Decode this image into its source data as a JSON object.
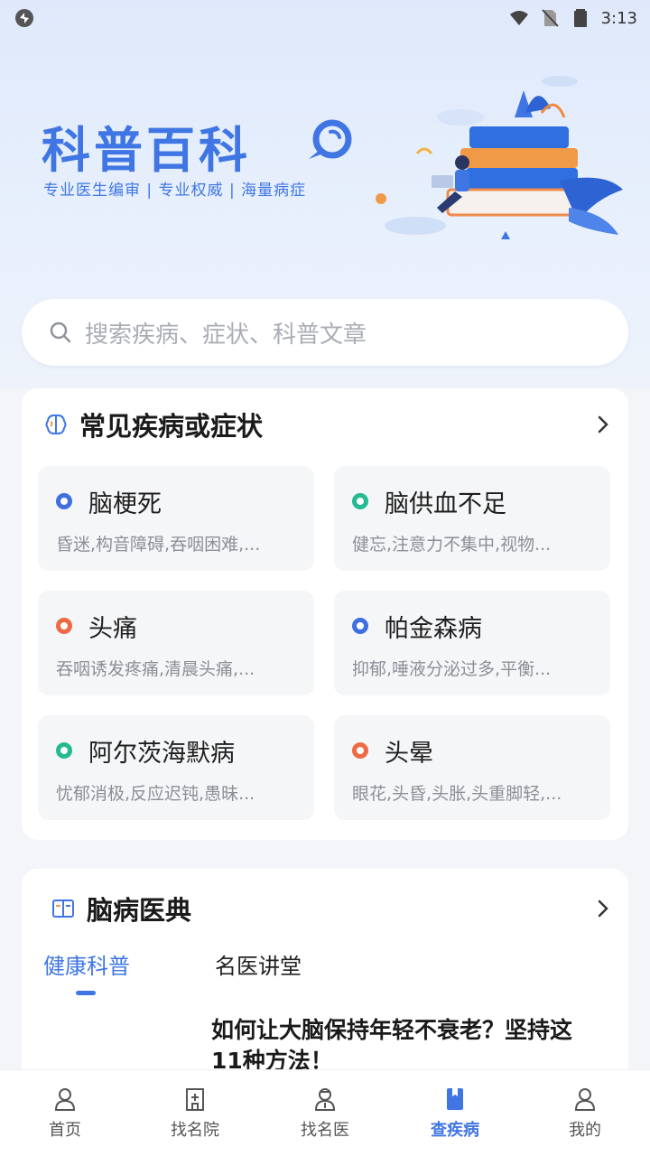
{
  "status_bar": {
    "time": "3:13"
  },
  "hero": {
    "title": "科普百科",
    "subtitle": "专业医生编审 | 专业权威 | 海量病症"
  },
  "search": {
    "placeholder": "搜索疾病、症状、科普文章"
  },
  "common_diseases": {
    "title": "常见疾病或症状",
    "items": [
      {
        "name": "脑梗死",
        "symptoms": "昏迷,构音障碍,吞咽困难,...",
        "dot_color": "#3f6fe0"
      },
      {
        "name": "脑供血不足",
        "symptoms": "健忘,注意力不集中,视物...",
        "dot_color": "#25b994"
      },
      {
        "name": "头痛",
        "symptoms": "吞咽诱发疼痛,清晨头痛,...",
        "dot_color": "#ee6a45"
      },
      {
        "name": "帕金森病",
        "symptoms": "抑郁,唾液分泌过多,平衡...",
        "dot_color": "#3f6fe0"
      },
      {
        "name": "阿尔茨海默病",
        "symptoms": "忧郁消极,反应迟钝,愚昧...",
        "dot_color": "#25b994"
      },
      {
        "name": "头晕",
        "symptoms": "眼花,头昏,头胀,头重脚轻,...",
        "dot_color": "#ee6a45"
      }
    ]
  },
  "encyclopedia": {
    "title": "脑病医典",
    "tabs": [
      {
        "label": "健康科普",
        "active": true
      },
      {
        "label": "名医讲堂",
        "active": false
      }
    ],
    "article_title": "如何让大脑保持年轻不衰老？坚持这11种方法！"
  },
  "bottom_nav": {
    "items": [
      {
        "label": "首页",
        "icon": "home-icon"
      },
      {
        "label": "找名院",
        "icon": "hospital-icon"
      },
      {
        "label": "找名医",
        "icon": "doctor-icon"
      },
      {
        "label": "查疾病",
        "icon": "book-icon",
        "active": true
      },
      {
        "label": "我的",
        "icon": "profile-icon"
      }
    ]
  },
  "colors": {
    "accent": "#3f76e4",
    "background": "#f3f5f9"
  }
}
